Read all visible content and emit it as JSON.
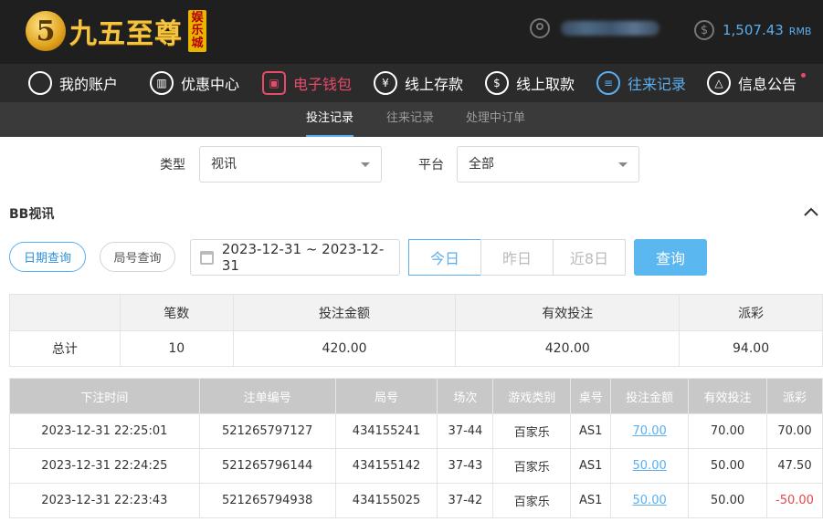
{
  "brand": {
    "logo_char": "5",
    "name": "九五至尊",
    "tag": "娱乐城"
  },
  "account": {
    "balance": "1,507.43",
    "currency": "RMB"
  },
  "nav": {
    "items": [
      {
        "label": "我的账户",
        "icon": "user-icon"
      },
      {
        "label": "优惠中心",
        "icon": "gift-icon"
      },
      {
        "label": "电子钱包",
        "icon": "wallet-icon"
      },
      {
        "label": "线上存款",
        "icon": "deposit-icon"
      },
      {
        "label": "线上取款",
        "icon": "withdraw-icon"
      },
      {
        "label": "往来记录",
        "icon": "records-icon"
      },
      {
        "label": "信息公告",
        "icon": "bell-icon"
      }
    ],
    "active_index": 5
  },
  "subnav": {
    "tabs": [
      "投注记录",
      "往来记录",
      "处理中订单"
    ],
    "active_index": 0
  },
  "filters": {
    "type_label": "类型",
    "type_value": "视讯",
    "platform_label": "平台",
    "platform_value": "全部"
  },
  "section": {
    "title": "BB视讯"
  },
  "query": {
    "date_query": "日期查询",
    "round_query": "局号查询",
    "date_range": "2023-12-31 ~ 2023-12-31",
    "today": "今日",
    "yesterday": "昨日",
    "last8": "近8日",
    "submit": "查询"
  },
  "summary": {
    "headers": [
      "",
      "笔数",
      "投注金额",
      "有效投注",
      "派彩"
    ],
    "row": [
      "总计",
      "10",
      "420.00",
      "420.00",
      "94.00"
    ]
  },
  "bets": {
    "headers": [
      "下注时间",
      "注单编号",
      "局号",
      "场次",
      "游戏类别",
      "桌号",
      "投注金额",
      "有效投注",
      "派彩"
    ],
    "rows": [
      [
        "2023-12-31 22:25:01",
        "521265797127",
        "434155241",
        "37-44",
        "百家乐",
        "AS1",
        "70.00",
        "70.00",
        "70.00"
      ],
      [
        "2023-12-31 22:24:25",
        "521265796144",
        "434155142",
        "37-43",
        "百家乐",
        "AS1",
        "50.00",
        "50.00",
        "47.50"
      ],
      [
        "2023-12-31 22:23:43",
        "521265794938",
        "434155025",
        "37-42",
        "百家乐",
        "AS1",
        "50.00",
        "50.00",
        "-50.00"
      ]
    ]
  },
  "colors": {
    "accent": "#5aaef0",
    "wallet": "#e84a6a",
    "negative": "#e5484d",
    "header_bg": "#1f1f1f"
  }
}
